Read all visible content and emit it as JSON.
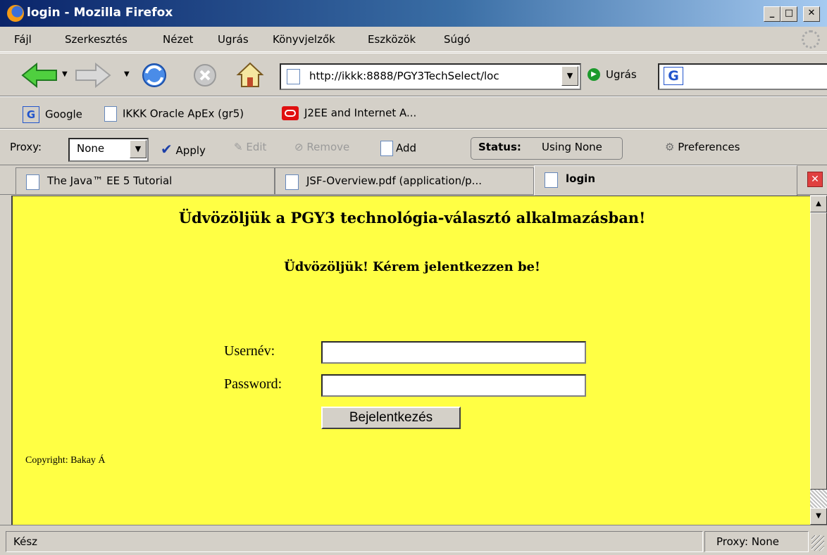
{
  "window": {
    "title": "login - Mozilla Firefox",
    "buttons": {
      "minimize": "_",
      "maximize": "□",
      "close": "✕"
    }
  },
  "menu": [
    "Fájl",
    "Szerkesztés",
    "Nézet",
    "Ugrás",
    "Könyvjelzők",
    "Eszközök",
    "Súgó"
  ],
  "nav": {
    "url": "http://ikkk:8888/PGY3TechSelect/loc",
    "go_label": "Ugrás",
    "search_value": ""
  },
  "bookmarks": [
    "Google",
    "IKKK Oracle ApEx (gr5)",
    "J2EE and Internet A..."
  ],
  "proxy_bar": {
    "label": "Proxy:",
    "selected": "None",
    "apply": "Apply",
    "edit": "Edit",
    "remove": "Remove",
    "add": "Add",
    "status_label": "Status:",
    "status_value": "Using None",
    "preferences": "Preferences"
  },
  "tabs": [
    {
      "label": "The Java™ EE 5 Tutorial",
      "active": false
    },
    {
      "label": "JSF-Overview.pdf (application/p...",
      "active": false
    },
    {
      "label": "login",
      "active": true
    }
  ],
  "page": {
    "heading": "Üdvözöljük a PGY3 technológia-választó alkalmazásban!",
    "subheading": "Üdvözöljük! Kérem jelentkezzen be!",
    "username_label": "Usernév:",
    "password_label": "Password:",
    "username_value": "",
    "password_value": "",
    "submit_label": "Bejelentkezés",
    "copyright": "Copyright: Bakay Á",
    "background_color": "#ffff44"
  },
  "statusbar": {
    "status": "Kész",
    "proxy": "Proxy: None"
  }
}
